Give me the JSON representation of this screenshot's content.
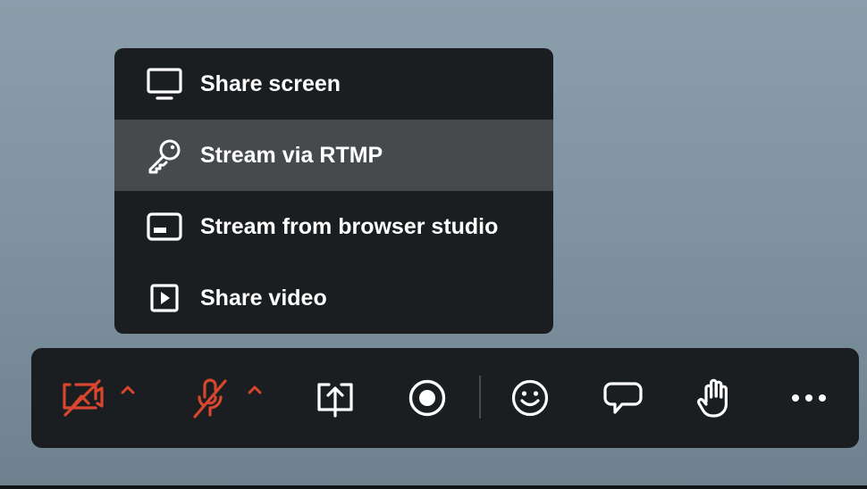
{
  "menu": {
    "items": [
      {
        "label": "Share screen",
        "icon": "monitor-icon",
        "highlighted": false
      },
      {
        "label": "Stream via RTMP",
        "icon": "key-icon",
        "highlighted": true
      },
      {
        "label": "Stream from browser studio",
        "icon": "studio-window-icon",
        "highlighted": false
      },
      {
        "label": "Share video",
        "icon": "play-video-icon",
        "highlighted": false
      }
    ]
  },
  "toolbar": {
    "buttons": [
      {
        "icon": "camera-off-icon",
        "state": "off",
        "has_caret": true
      },
      {
        "icon": "microphone-muted-icon",
        "state": "muted",
        "has_caret": true
      },
      {
        "icon": "share-upload-icon"
      },
      {
        "icon": "record-icon"
      },
      {
        "icon": "emoji-smile-icon"
      },
      {
        "icon": "chat-bubble-icon"
      },
      {
        "icon": "raise-hand-icon"
      },
      {
        "icon": "more-options-icon"
      }
    ]
  },
  "colors": {
    "panel_bg": "#1b1e20",
    "menu_highlight": "#474a4d",
    "text": "#ffffff",
    "alert_red": "#d8462f",
    "background": "#8b9eab"
  }
}
